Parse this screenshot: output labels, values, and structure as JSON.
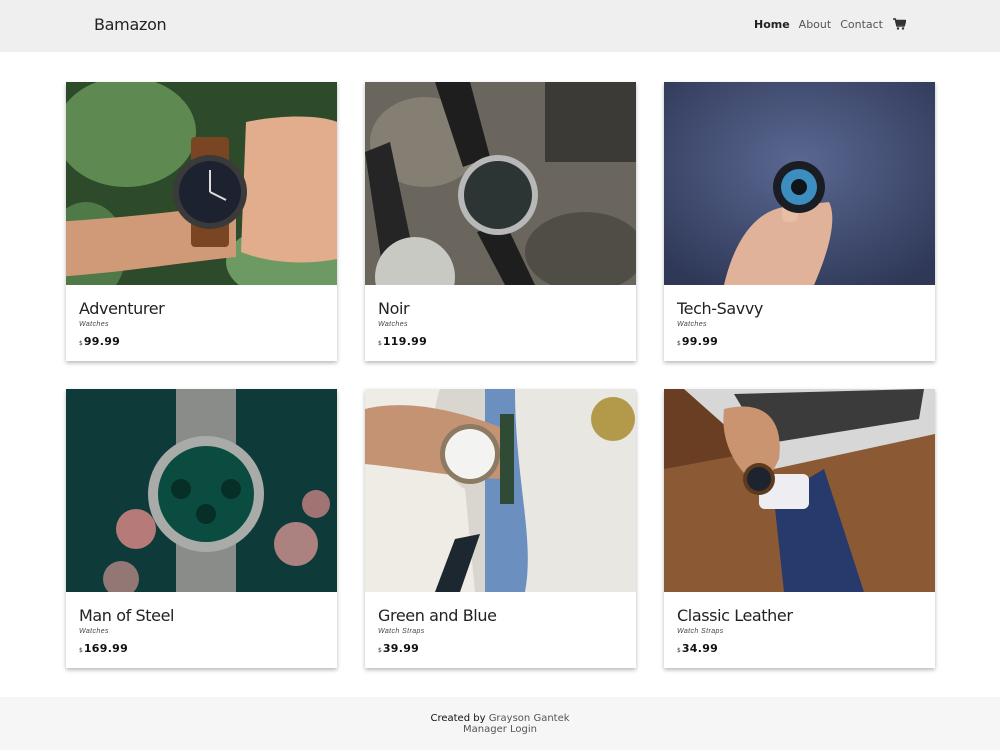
{
  "navbar": {
    "brand": "Bamazon",
    "links": [
      {
        "label": "Home",
        "active": true
      },
      {
        "label": "About",
        "active": false
      },
      {
        "label": "Contact",
        "active": false
      }
    ],
    "cart_icon": "shopping-cart-icon"
  },
  "products": [
    {
      "name": "Adventurer",
      "category": "Watches",
      "currency": "$",
      "price": "99.99"
    },
    {
      "name": "Noir",
      "category": "Watches",
      "currency": "$",
      "price": "119.99"
    },
    {
      "name": "Tech-Savvy",
      "category": "Watches",
      "currency": "$",
      "price": "99.99"
    },
    {
      "name": "Man of Steel",
      "category": "Watches",
      "currency": "$",
      "price": "169.99"
    },
    {
      "name": "Green and Blue",
      "category": "Watch Straps",
      "currency": "$",
      "price": "39.99"
    },
    {
      "name": "Classic Leather",
      "category": "Watch Straps",
      "currency": "$",
      "price": "34.99"
    }
  ],
  "footer": {
    "created_by": "Created by",
    "author": "Grayson Gantek",
    "manager_login": "Manager Login"
  }
}
